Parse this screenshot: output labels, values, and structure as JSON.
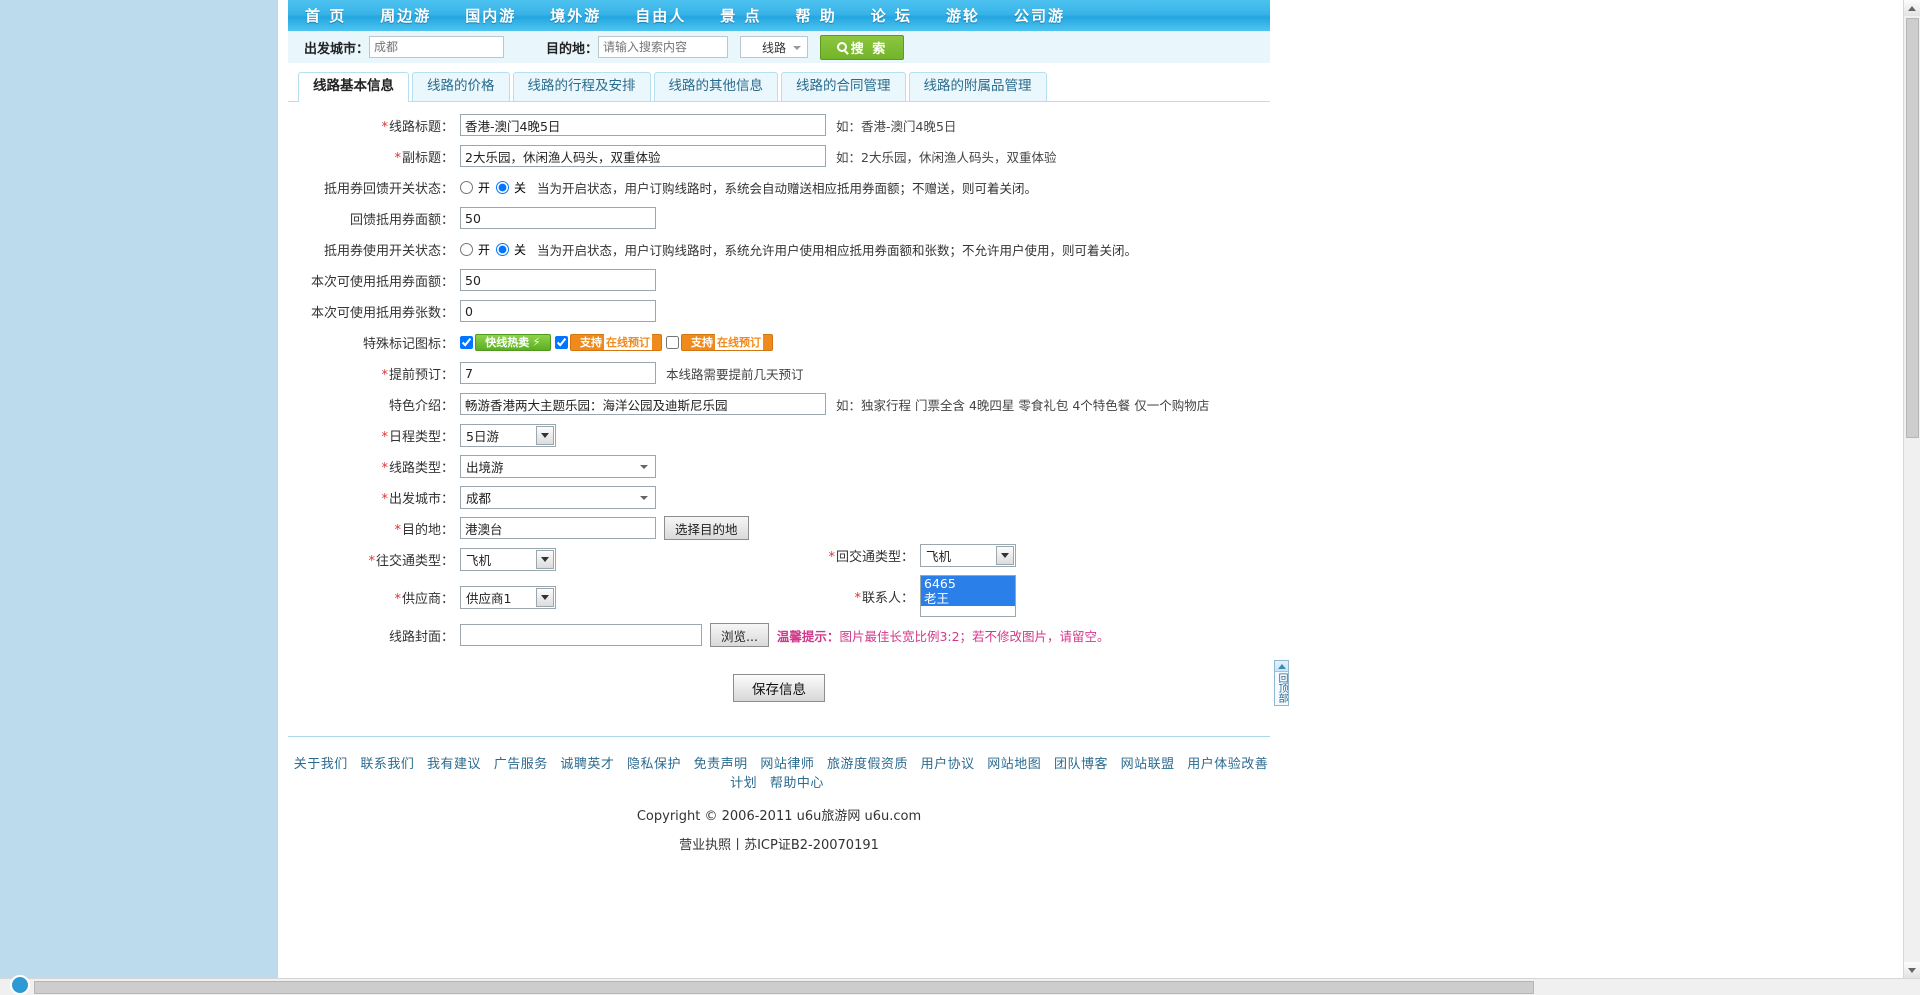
{
  "nav": {
    "items": [
      {
        "label": "首 页"
      },
      {
        "label": "周边游"
      },
      {
        "label": "国内游"
      },
      {
        "label": "境外游"
      },
      {
        "label": "自由人"
      },
      {
        "label": "景 点"
      },
      {
        "label": "帮 助"
      },
      {
        "label": "论 坛"
      },
      {
        "label": "游轮"
      },
      {
        "label": "公司游"
      }
    ]
  },
  "search": {
    "dep_label": "出发城市：",
    "dep_placeholder": "成都",
    "dep_value": "",
    "dest_label": "目的地：",
    "dest_placeholder": "请输入搜索内容",
    "dest_value": "",
    "type_value": "线路",
    "button": "搜 索"
  },
  "tabs": [
    {
      "label": "线路基本信息",
      "active": true
    },
    {
      "label": "线路的价格",
      "active": false
    },
    {
      "label": "线路的行程及安排",
      "active": false
    },
    {
      "label": "线路的其他信息",
      "active": false
    },
    {
      "label": "线路的合同管理",
      "active": false
    },
    {
      "label": "线路的附属品管理",
      "active": false
    }
  ],
  "form": {
    "title": {
      "label": "线路标题：",
      "required": true,
      "value": "香港-澳门4晚5日",
      "hint": "如：香港-澳门4晚5日"
    },
    "subtitle": {
      "label": "副标题：",
      "required": true,
      "value": "2大乐园，休闲渔人码头，双重体验",
      "hint": "如：2大乐园，休闲渔人码头，双重体验"
    },
    "coupon_feedback_switch": {
      "label": "抵用券回馈开关状态：",
      "required": false,
      "on_label": "开",
      "off_label": "关",
      "selected": "off",
      "note": "当为开启状态，用户订购线路时，系统会自动赠送相应抵用券面额；不赠送，则可着关闭。"
    },
    "feedback_amount": {
      "label": "回馈抵用券面额：",
      "required": false,
      "value": "50"
    },
    "coupon_use_switch": {
      "label": "抵用券使用开关状态：",
      "required": false,
      "on_label": "开",
      "off_label": "关",
      "selected": "off",
      "note": "当为开启状态，用户订购线路时，系统允许用户使用相应抵用券面额和张数；不允许用户使用，则可着关闭。"
    },
    "usable_amount": {
      "label": "本次可使用抵用券面额：",
      "required": false,
      "value": "50"
    },
    "usable_count": {
      "label": "本次可使用抵用券张数：",
      "required": false,
      "value": "0"
    },
    "special_icons": {
      "label": "特殊标记图标：",
      "required": false,
      "options": [
        {
          "badge": "快线热卖",
          "checked": true,
          "style": "green"
        },
        {
          "badge_prefix": "支持",
          "badge_main": "在线预订",
          "checked": true,
          "style": "orange"
        },
        {
          "badge_prefix": "支持",
          "badge_main": "在线预订",
          "checked": false,
          "style": "orange"
        }
      ]
    },
    "advance_days": {
      "label": "提前预订：",
      "required": true,
      "value": "7",
      "hint": "本线路需要提前几天预订"
    },
    "feature_intro": {
      "label": "特色介绍：",
      "required": false,
      "value": "畅游香港两大主题乐园：海洋公园及迪斯尼乐园",
      "hint": "如：独家行程 门票全含 4晚四星 零食礼包 4个特色餐 仅一个购物店"
    },
    "schedule_type": {
      "label": "日程类型：",
      "required": true,
      "value": "5日游"
    },
    "route_type": {
      "label": "线路类型：",
      "required": true,
      "value": "出境游"
    },
    "departure_city": {
      "label": "出发城市：",
      "required": true,
      "value": "成都"
    },
    "destination": {
      "label": "目的地：",
      "required": true,
      "value": "港澳台",
      "button": "选择目的地"
    },
    "outbound_transport": {
      "label": "往交通类型：",
      "required": true,
      "value": "飞机"
    },
    "return_transport": {
      "label": "回交通类型：",
      "required": true,
      "value": "飞机"
    },
    "supplier": {
      "label": "供应商：",
      "required": true,
      "value": "供应商1"
    },
    "contact": {
      "label": "联系人：",
      "required": true,
      "options": [
        "6465",
        "老王"
      ]
    },
    "cover": {
      "label": "线路封面：",
      "required": false,
      "value": "",
      "browse": "浏览...",
      "tip_prefix": "温馨提示：",
      "tip_body": "图片最佳长宽比例3:2；若不修改图片，请留空。"
    },
    "save_button": "保存信息"
  },
  "backtop": {
    "label": "回顶部"
  },
  "footer": {
    "links": [
      "关于我们",
      "联系我们",
      "我有建议",
      "广告服务",
      "诚聘英才",
      "隐私保护",
      "免责声明",
      "网站律师",
      "旅游度假资质",
      "用户协议",
      "网站地图",
      "团队博客",
      "网站联盟",
      "用户体验改善计划",
      "帮助中心"
    ],
    "copyright": "Copyright © 2006-2011 u6u旅游网 u6u.com",
    "license": "营业执照丨苏ICP证B2-20070191"
  }
}
